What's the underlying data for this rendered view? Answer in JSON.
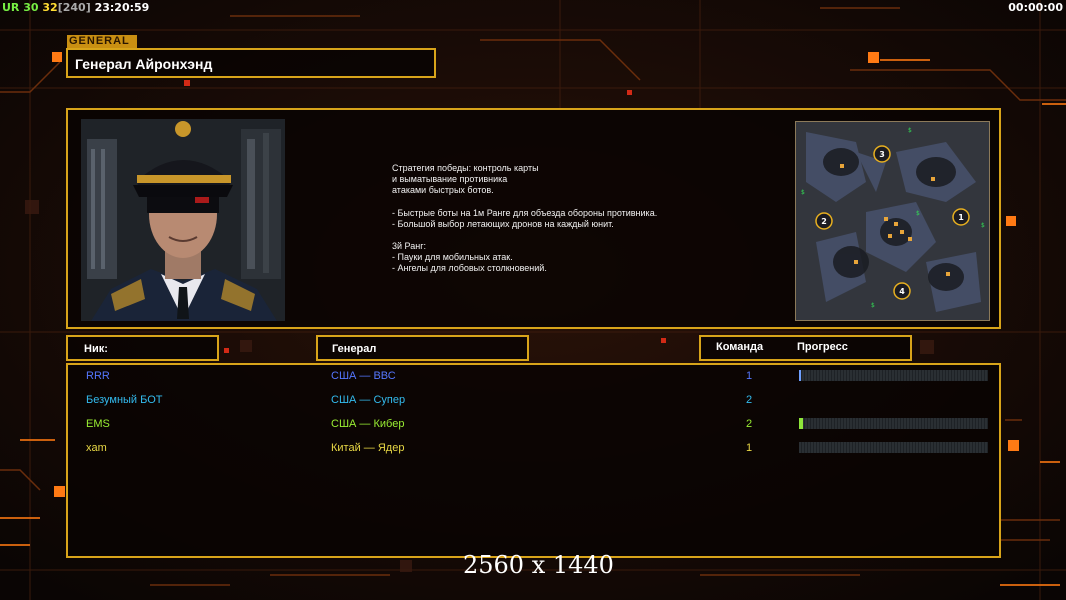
{
  "hud": {
    "ur_label": "UR",
    "fps_1": "30",
    "fps_2": "32",
    "fps_3": "[240]",
    "clock": "23:20:59",
    "timer": "00:00:00"
  },
  "general": {
    "tag": "GENERAL",
    "name": "Генерал Айронхэнд"
  },
  "strategy_lines": [
    "Стратегия победы: контроль карты",
    "и выматывание противника",
    "атаками быстрых ботов.",
    "",
    "- Быстрые боты на 1м Ранге для объезда обороны противника.",
    "- Большой выбор летающих дронов на каждый юнит.",
    "",
    "3й Ранг:",
    "- Пауки для мобильных атак.",
    "- Ангелы для лобовых столкновений."
  ],
  "minimap": {
    "spawns": [
      "1",
      "2",
      "3",
      "4"
    ]
  },
  "columns": {
    "nick": "Ник:",
    "general": "Генерал",
    "team": "Команда",
    "progress": "Прогресс"
  },
  "players": [
    {
      "nick": "RRR",
      "general": "США — ВВС",
      "team": "1",
      "color": "#5577ff",
      "progress": 0.01,
      "show_bar": true
    },
    {
      "nick": "Безумный БОТ",
      "general": "США — Супер",
      "team": "2",
      "color": "#33bbee",
      "progress": 0,
      "show_bar": false
    },
    {
      "nick": "EMS",
      "general": "США — Кибер",
      "team": "2",
      "color": "#99ee33",
      "progress": 0.02,
      "show_bar": true
    },
    {
      "nick": "xam",
      "general": "Китай — Ядер",
      "team": "1",
      "color": "#e8d845",
      "progress": 0,
      "show_bar": true
    }
  ],
  "resolution_label": "2560 x 1440",
  "colors": {
    "accent_gold": "#d8a41a",
    "hud_ur": "#77ee44",
    "hud_fps": "#ffdd33",
    "bar_fill_blue": "#6fa0ff",
    "bar_fill_green": "#8ee63a"
  }
}
